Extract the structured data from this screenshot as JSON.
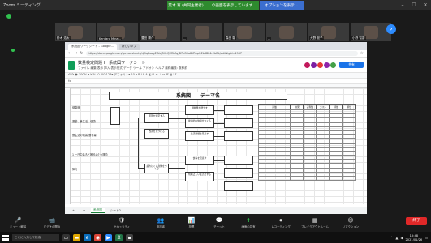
{
  "zoom": {
    "window_title": "Zoom ミーティング",
    "banner_green": "荒木 育 (共同主催者)",
    "banner_green2": "の画面を表示しています",
    "banner_blue": "オプションを表示 ⌄",
    "end_button": "終了",
    "participants": [
      {
        "name": "鈴木 浩太"
      },
      {
        "name": "Kentaro Mina..."
      },
      {
        "name": "豊田 陽介"
      },
      {
        "name": "..."
      },
      {
        "name": "森田 駿"
      },
      {
        "name": "..."
      },
      {
        "name": "大野 聡子"
      },
      {
        "name": "小野 智香"
      }
    ],
    "controls": [
      {
        "icon": "microphone-icon",
        "glyph": "🎤",
        "label": "ミュート解除"
      },
      {
        "icon": "video-icon",
        "glyph": "📹",
        "label": "ビデオの開始"
      },
      {
        "icon": "security-icon",
        "glyph": "🛡",
        "label": "セキュリティ"
      },
      {
        "icon": "participants-icon",
        "glyph": "👥",
        "label": "参加者"
      },
      {
        "icon": "poll-icon",
        "glyph": "📊",
        "label": "投票"
      },
      {
        "icon": "chat-icon",
        "glyph": "💬",
        "label": "チャット"
      },
      {
        "icon": "share-screen-icon",
        "glyph": "⬆",
        "label": "画面の共有"
      },
      {
        "icon": "record-icon",
        "glyph": "⏺",
        "label": "レコーディング"
      },
      {
        "icon": "breakout-icon",
        "glyph": "▦",
        "label": "ブレイクアウトルーム"
      },
      {
        "icon": "reaction-icon",
        "glyph": "☺",
        "label": "リアクション"
      }
    ]
  },
  "browser": {
    "tabs": [
      "系統図ワークシート - Google...",
      "新しいタブ"
    ],
    "url": "https://docs.google.com/spreadsheets/d/1qBoxgEtNcJ3HcQVRbAyJB7eG0a8YRnpQEb8Bk4r2bDk/edit#gid=1987"
  },
  "sheets": {
    "doc_title": "数量検定問題 Ⅰ　系統図ワークシート",
    "menu": "ファイル  編集  表示  挿入  表示形式  データ  ツール  アドオン  ヘルプ  最終編集: 数秒前",
    "share_label": "共有",
    "toolbar": "↶  ↷  🖶  100% ▾  ¥  %  .0  .00  123▾  デフォルト▾  10 ▾  B  I  S  A  ◧  ⊞  ≡  ⊥  ↔  ⌘  ▦  ⫶  Σ",
    "formula_cell": "fx",
    "diagram_title": "系統図　　テーマ名",
    "left_labels": [
      "健康度",
      "運動、食生活、健康",
      "食生活の改善  食事量",
      "1 一日中あると困るの? ※運動",
      "体力"
    ],
    "boxes": [
      "原因を特定する",
      "改善を見つける",
      "疲れにくい身体をつくる",
      "運動量を増やす",
      "健康的な体質をつくる",
      "生活習慣を見直す",
      "食事を見直す",
      "規則正しい生活をする"
    ],
    "right_header": [
      "評価",
      "効果",
      "実現性",
      "コスト",
      "評価",
      "順位"
    ],
    "sheet_tabs": [
      "+",
      "≡",
      "系統図",
      "シート2"
    ]
  },
  "taskbar": {
    "search_placeholder": "ここに入力して検索",
    "time": "15:48",
    "date": "2021/01/26"
  },
  "colors": {
    "zoom_green": "#31c14f",
    "zoom_blue": "#2d8cff",
    "end_red": "#e02828",
    "sheets_green": "#0f9d58",
    "share_blue": "#1a73e8"
  }
}
